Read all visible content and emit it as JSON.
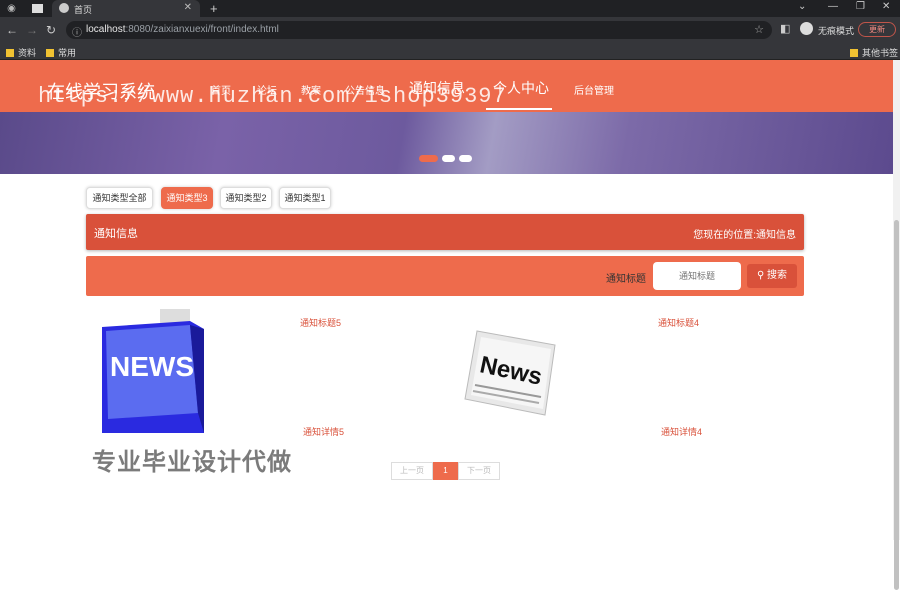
{
  "browser": {
    "tab_title": "首页",
    "url_host": "localhost",
    "url_rest": ":8080/zaixianxuexi/front/index.html",
    "incognito_label": "无痕模式",
    "update_label": "更新",
    "bookmarks": [
      "资料",
      "常用"
    ],
    "other_bookmarks": "其他书签"
  },
  "header": {
    "site_title": "在线学习系统",
    "menu": [
      "首页",
      "论坛",
      "教案",
      "公告信息",
      "通知信息",
      "个人中心",
      "后台管理"
    ],
    "accent": "#ee6b4c"
  },
  "filters": [
    "通知类型全部",
    "通知类型3",
    "通知类型2",
    "通知类型1"
  ],
  "active_filter": "通知类型3",
  "breadcrumb": {
    "section": "通知信息",
    "location_prefix": "您现在的位置:",
    "location": "通知信息"
  },
  "search": {
    "label": "通知标题",
    "placeholder": "通知标题",
    "button": "搜索"
  },
  "cards": [
    {
      "title": "通知标题5",
      "detail": "通知详情5",
      "image_text": "NEWS",
      "icon": "news-key-image"
    },
    {
      "title": "通知标题4",
      "detail": "通知详情4",
      "image_text": "News",
      "icon": "newspaper-image"
    }
  ],
  "pagination": {
    "prev": "上一页",
    "current": "1",
    "next": "下一页"
  },
  "watermarks": {
    "url": "https://www.huzhan.com/ishop39397",
    "promo": "专业毕业设计代做"
  }
}
